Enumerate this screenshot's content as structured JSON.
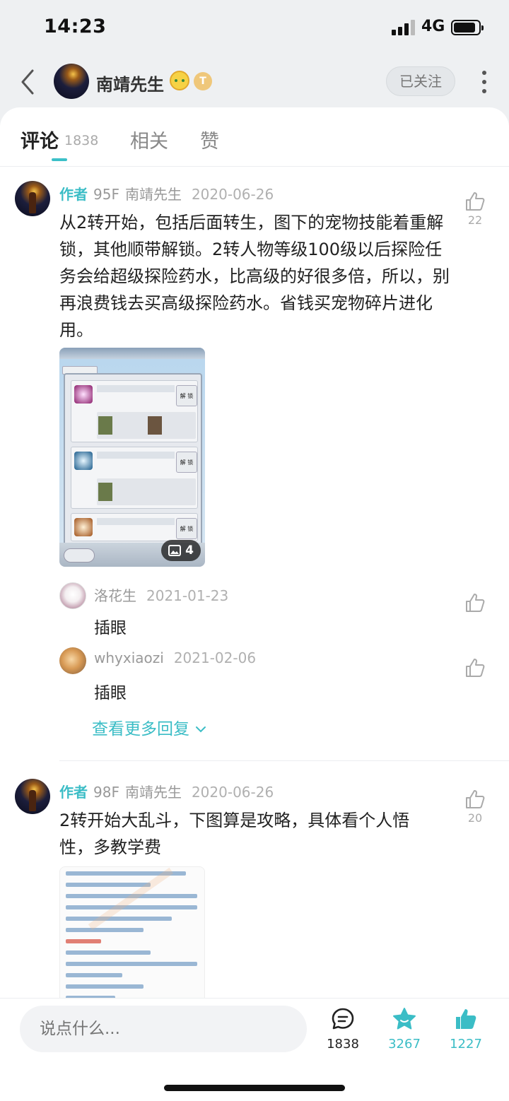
{
  "status": {
    "time": "14:23",
    "network": "4G"
  },
  "header": {
    "username": "南靖先生",
    "level_badge": "T",
    "follow_label": "已关注"
  },
  "tabs": [
    {
      "label": "评论",
      "count": "1838"
    },
    {
      "label": "相关"
    },
    {
      "label": "赞"
    }
  ],
  "comments": [
    {
      "author_tag": "作者",
      "floor": "95F",
      "author": "南靖先生",
      "date": "2020-06-26",
      "likes": "22",
      "text": "从2转开始，包括后面转生，图下的宠物技能着重解锁，其他顺带解锁。2转人物等级100级以后探险任务会给超级探险药水，比高级的好很多倍，所以，别再浪费钱去买高级探险药水。省钱买宠物碎片进化用。",
      "image_count": "4",
      "replies": [
        {
          "author": "洛花生",
          "date": "2021-01-23",
          "text": "插眼"
        },
        {
          "author": "whyxiaozi",
          "date": "2021-02-06",
          "text": "插眼"
        }
      ],
      "more_replies_label": "查看更多回复"
    },
    {
      "author_tag": "作者",
      "floor": "98F",
      "author": "南靖先生",
      "date": "2020-06-26",
      "likes": "20",
      "text": "2转开始大乱斗，下图算是攻略，具体看个人悟性，多教学费"
    }
  ],
  "bottom_bar": {
    "input_placeholder": "说点什么...",
    "comment_count": "1838",
    "star_count": "3267",
    "like_count": "1227"
  },
  "colors": {
    "accent": "#3bbdc6"
  }
}
